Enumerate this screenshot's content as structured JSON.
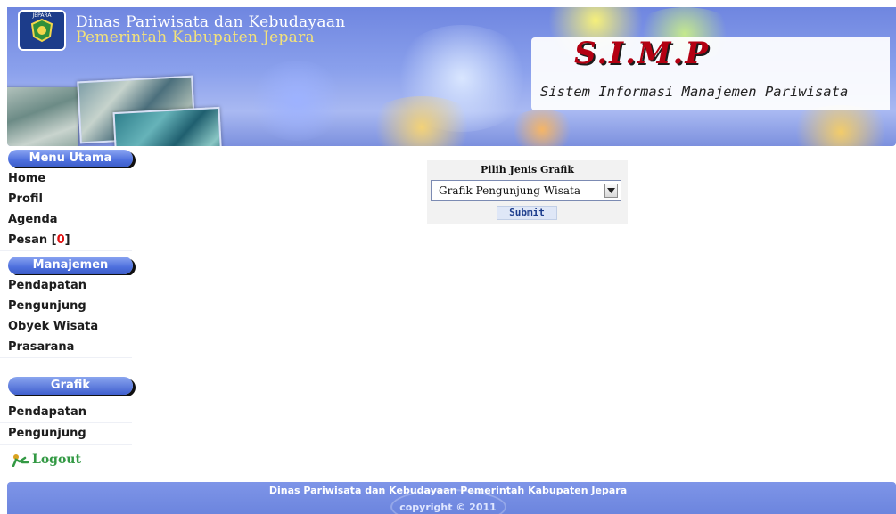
{
  "header": {
    "logo_text": "JEPARA",
    "agency_line1": "Dinas Pariwisata dan Kebudayaan",
    "agency_line2": "Pemerintah Kabupaten Jepara",
    "app_name": "S.I.M.P",
    "app_subtitle": "Sistem Informasi Manajemen Pariwisata"
  },
  "sidebar": {
    "section_main": "Menu Utama",
    "main_items": [
      {
        "label": "Home"
      },
      {
        "label": "Profil"
      },
      {
        "label": "Agenda"
      },
      {
        "label": "Pesan ["
      }
    ],
    "message_count": "0",
    "message_close": "]",
    "section_manage": "Manajemen",
    "manage_items": [
      {
        "label": "Pendapatan"
      },
      {
        "label": "Pengunjung"
      },
      {
        "label": "Obyek Wisata"
      },
      {
        "label": "Prasarana"
      }
    ],
    "section_chart": "Grafik",
    "chart_items": [
      {
        "label": "Pendapatan"
      },
      {
        "label": "Pengunjung"
      }
    ],
    "logout_label": "Logout",
    "logout_icon": "logout-icon"
  },
  "form": {
    "title": "Pilih Jenis Grafik",
    "selected_option": "Grafik Pengunjung Wisata",
    "submit_label": "Submit"
  },
  "footer": {
    "line1": "Dinas Pariwisata dan Kebudayaan Pemerintah Kabupaten Jepara",
    "line2": "copyright © 2011"
  },
  "colors": {
    "header_blue": "#7c90de",
    "sidebar_pill": "#4d6fdd",
    "message_count_red": "#e01010",
    "app_name_red": "#b40012"
  }
}
